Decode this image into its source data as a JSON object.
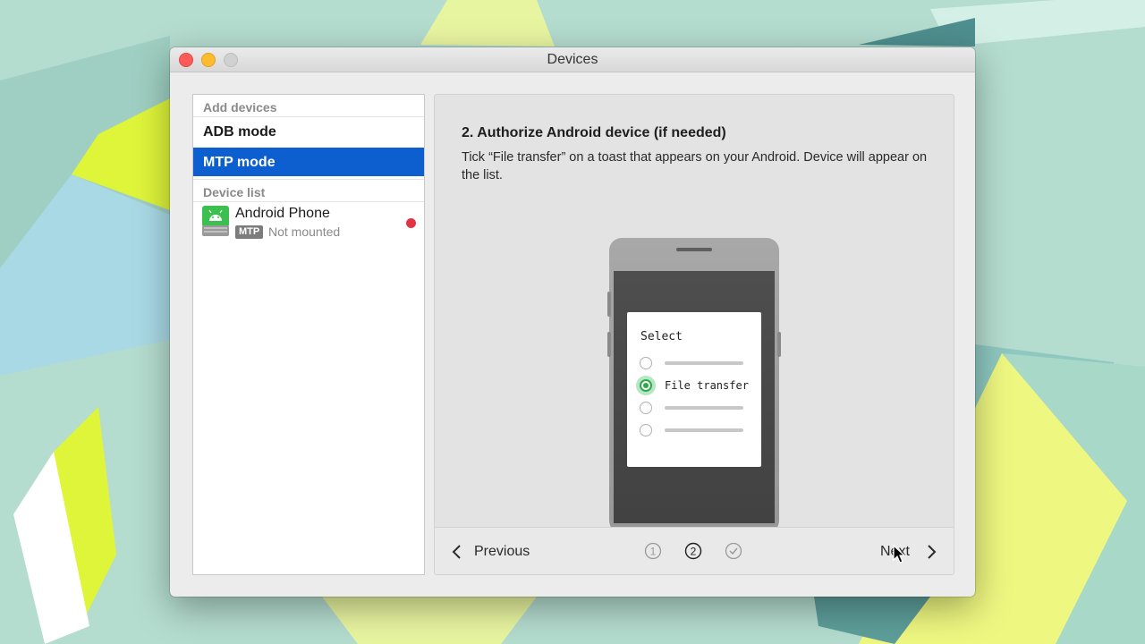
{
  "window": {
    "title": "Devices"
  },
  "sidebar": {
    "add_devices_header": "Add devices",
    "items": [
      {
        "label": "ADB mode",
        "selected": false
      },
      {
        "label": "MTP mode",
        "selected": true
      }
    ],
    "device_list_header": "Device list",
    "devices": [
      {
        "name": "Android Phone",
        "badge": "MTP",
        "status": "Not mounted",
        "status_color": "#e23344",
        "icon": "android-drive-icon"
      }
    ]
  },
  "content": {
    "step_title": "2. Authorize Android device (if needed)",
    "step_description": "Tick “File transfer” on a toast that appears on your Android. Device will appear on the list.",
    "illustration": {
      "dialog_title": "Select",
      "options": [
        {
          "label": "",
          "selected": false
        },
        {
          "label": "File transfer",
          "selected": true
        },
        {
          "label": "",
          "selected": false
        },
        {
          "label": "",
          "selected": false
        }
      ]
    }
  },
  "navigation": {
    "previous_label": "Previous",
    "next_label": "Next",
    "steps": [
      {
        "label": "1",
        "state": "inactive"
      },
      {
        "label": "2",
        "state": "current"
      },
      {
        "label": "✓",
        "state": "inactive"
      }
    ]
  },
  "colors": {
    "accent": "#0d5fd0",
    "radio_selected": "#2ba84a",
    "close": "#fc5b57",
    "minimize": "#fdbb2f"
  }
}
